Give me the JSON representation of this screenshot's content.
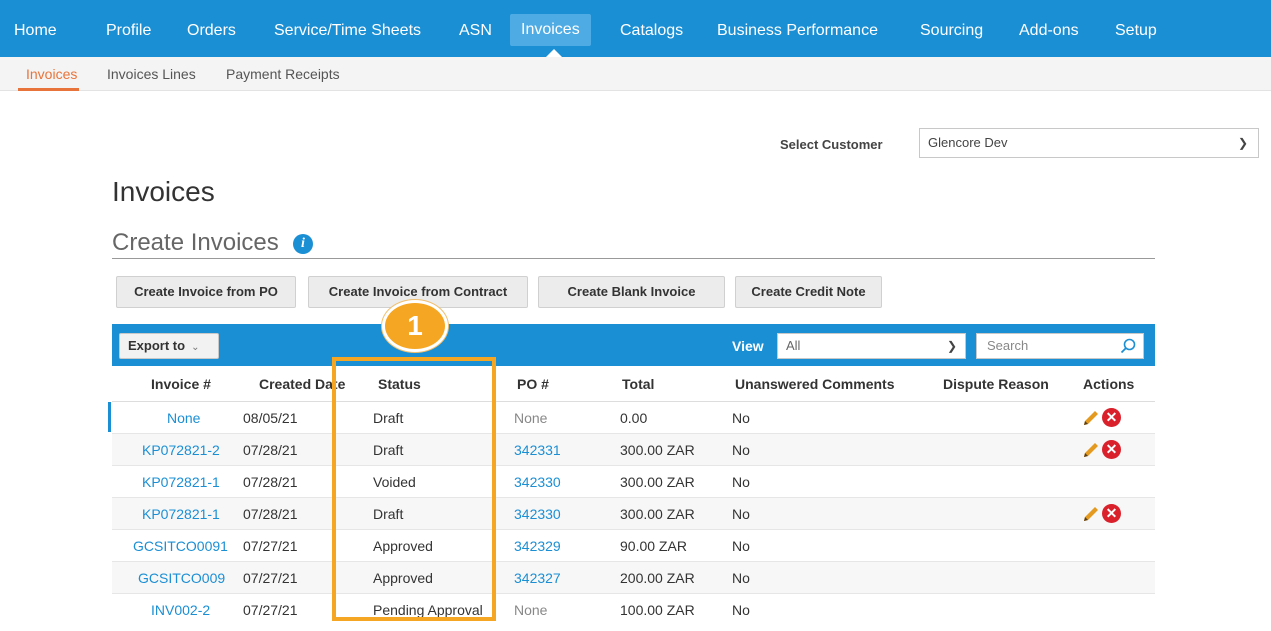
{
  "topnav": {
    "items": [
      "Home",
      "Profile",
      "Orders",
      "Service/Time Sheets",
      "ASN",
      "Invoices",
      "Catalogs",
      "Business Performance",
      "Sourcing",
      "Add-ons",
      "Setup"
    ]
  },
  "subnav": {
    "items": [
      "Invoices",
      "Invoices Lines",
      "Payment Receipts"
    ]
  },
  "customer": {
    "label": "Select Customer",
    "value": "Glencore Dev"
  },
  "page_title": "Invoices",
  "section_title": "Create Invoices",
  "buttons": {
    "from_po": "Create Invoice from PO",
    "from_contract": "Create Invoice from Contract",
    "blank": "Create Blank Invoice",
    "credit": "Create Credit Note"
  },
  "toolbar": {
    "export": "Export to",
    "view_label": "View",
    "view_value": "All",
    "search_placeholder": "Search"
  },
  "badge": "1",
  "table": {
    "headers": [
      "Invoice #",
      "Created Date",
      "Status",
      "PO #",
      "Total",
      "Unanswered Comments",
      "Dispute Reason",
      "Actions"
    ],
    "rows": [
      {
        "invoice": "None",
        "date": "08/05/21",
        "status": "Draft",
        "po": "None",
        "total": "0.00",
        "comments": "No"
      },
      {
        "invoice": "KP072821-2",
        "date": "07/28/21",
        "status": "Draft",
        "po": "342331",
        "total": "300.00 ZAR",
        "comments": "No"
      },
      {
        "invoice": "KP072821-1",
        "date": "07/28/21",
        "status": "Voided",
        "po": "342330",
        "total": "300.00 ZAR",
        "comments": "No"
      },
      {
        "invoice": "KP072821-1",
        "date": "07/28/21",
        "status": "Draft",
        "po": "342330",
        "total": "300.00 ZAR",
        "comments": "No"
      },
      {
        "invoice": "GCSITCO0091",
        "date": "07/27/21",
        "status": "Approved",
        "po": "342329",
        "total": "90.00 ZAR",
        "comments": "No"
      },
      {
        "invoice": "GCSITCO009",
        "date": "07/27/21",
        "status": "Approved",
        "po": "342327",
        "total": "200.00 ZAR",
        "comments": "No"
      },
      {
        "invoice": "INV002-2",
        "date": "07/27/21",
        "status": "Pending Approval",
        "po": "None",
        "total": "100.00 ZAR",
        "comments": "No"
      }
    ]
  },
  "colors": {
    "nav": "#1b8fd4",
    "accent": "#e8743b",
    "highlight": "#f5a623",
    "delete": "#d9202b"
  }
}
